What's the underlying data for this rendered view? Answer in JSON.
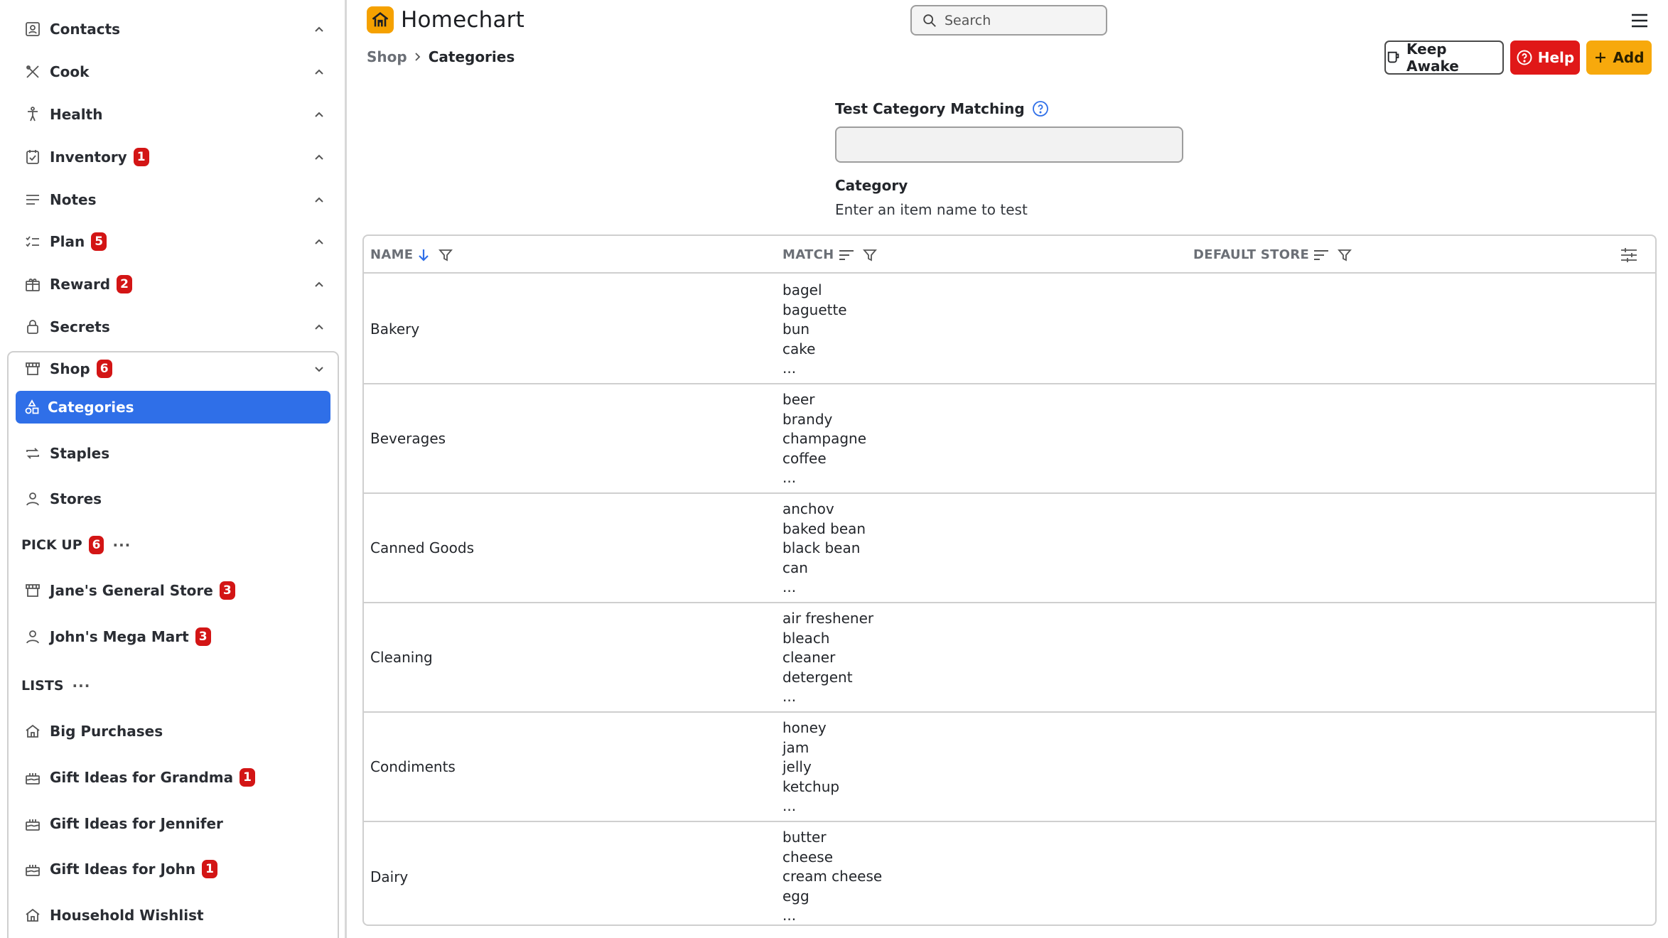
{
  "sidebar": {
    "items": [
      {
        "label": "Contacts",
        "icon": "contacts-icon",
        "badge": ""
      },
      {
        "label": "Cook",
        "icon": "utensils-icon",
        "badge": ""
      },
      {
        "label": "Health",
        "icon": "person-icon",
        "badge": ""
      },
      {
        "label": "Inventory",
        "icon": "inventory-icon",
        "badge": "1"
      },
      {
        "label": "Notes",
        "icon": "notes-icon",
        "badge": ""
      },
      {
        "label": "Plan",
        "icon": "checklist-icon",
        "badge": "5"
      },
      {
        "label": "Reward",
        "icon": "gift-icon",
        "badge": "2"
      },
      {
        "label": "Secrets",
        "icon": "lock-icon",
        "badge": ""
      }
    ],
    "shop": {
      "label": "Shop",
      "badge": "6",
      "subitems": [
        {
          "label": "Categories",
          "icon": "shapes-icon"
        },
        {
          "label": "Staples",
          "icon": "repeat-icon"
        },
        {
          "label": "Stores",
          "icon": "person-icon"
        }
      ],
      "pickup": {
        "header": "PICK UP",
        "badge": "6",
        "more": "···",
        "items": [
          {
            "label": "Jane's General Store",
            "badge": "3",
            "icon": "store-icon"
          },
          {
            "label": "John's Mega Mart",
            "badge": "3",
            "icon": "person-icon"
          }
        ]
      },
      "lists": {
        "header": "LISTS",
        "more": "···",
        "items": [
          {
            "label": "Big Purchases",
            "badge": "",
            "icon": "house-icon"
          },
          {
            "label": "Gift Ideas for Grandma",
            "badge": "1",
            "icon": "cake-icon"
          },
          {
            "label": "Gift Ideas for Jennifer",
            "badge": "",
            "icon": "cake-icon"
          },
          {
            "label": "Gift Ideas for John",
            "badge": "1",
            "icon": "cake-icon"
          },
          {
            "label": "Household Wishlist",
            "badge": "",
            "icon": "house-icon"
          }
        ]
      }
    }
  },
  "header": {
    "app_name": "Homechart",
    "search_placeholder": "Search"
  },
  "breadcrumb": {
    "parent": "Shop",
    "current": "Categories"
  },
  "toolbar": {
    "keep_awake": "Keep Awake",
    "help": "Help",
    "add": "Add"
  },
  "test_matching": {
    "label": "Test Category Matching",
    "input_value": "",
    "result_label": "Category",
    "result_text": "Enter an item name to test"
  },
  "table": {
    "columns": {
      "name": "NAME",
      "match": "MATCH",
      "default_store": "DEFAULT STORE"
    },
    "rows": [
      {
        "name": "Bakery",
        "match": [
          "bagel",
          "baguette",
          "bun",
          "cake",
          "..."
        ]
      },
      {
        "name": "Beverages",
        "match": [
          "beer",
          "brandy",
          "champagne",
          "coffee",
          "..."
        ]
      },
      {
        "name": "Canned Goods",
        "match": [
          "anchov",
          "baked bean",
          "black bean",
          "can",
          "..."
        ]
      },
      {
        "name": "Cleaning",
        "match": [
          "air freshener",
          "bleach",
          "cleaner",
          "detergent",
          "..."
        ]
      },
      {
        "name": "Condiments",
        "match": [
          "honey",
          "jam",
          "jelly",
          "ketchup",
          "..."
        ]
      },
      {
        "name": "Dairy",
        "match": [
          "butter",
          "cheese",
          "cream cheese",
          "egg",
          "..."
        ]
      }
    ]
  },
  "colors": {
    "accent": "#2f6fe8",
    "badge": "#d31515",
    "help_button": "#e01818",
    "add_button": "#f7a90c",
    "logo": "#f5a100"
  }
}
